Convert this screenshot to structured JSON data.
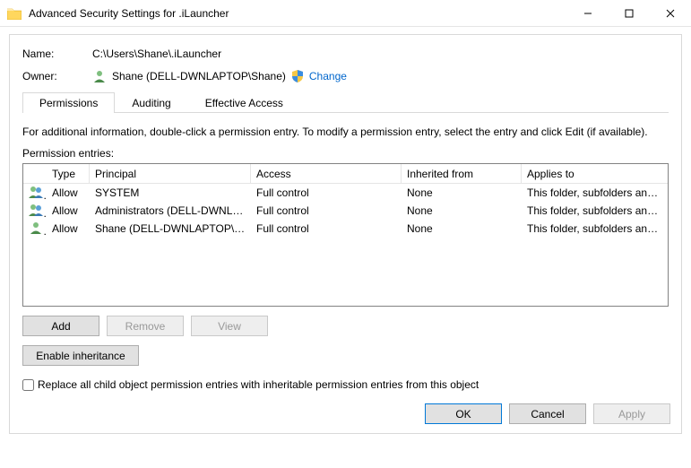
{
  "window": {
    "title": "Advanced Security Settings for .iLauncher"
  },
  "fields": {
    "name_label": "Name:",
    "name_value": "C:\\Users\\Shane\\.iLauncher",
    "owner_label": "Owner:",
    "owner_value": "Shane (DELL-DWNLAPTOP\\Shane)",
    "change_link": "Change"
  },
  "tabs": {
    "permissions": "Permissions",
    "auditing": "Auditing",
    "effective": "Effective Access"
  },
  "info_text": "For additional information, double-click a permission entry. To modify a permission entry, select the entry and click Edit (if available).",
  "entries_label": "Permission entries:",
  "columns": {
    "type": "Type",
    "principal": "Principal",
    "access": "Access",
    "inherited": "Inherited from",
    "applies": "Applies to"
  },
  "entries": [
    {
      "icon": "group",
      "type": "Allow",
      "principal": "SYSTEM",
      "access": "Full control",
      "inherited": "None",
      "applies": "This folder, subfolders and files"
    },
    {
      "icon": "group",
      "type": "Allow",
      "principal": "Administrators (DELL-DWNLA...",
      "access": "Full control",
      "inherited": "None",
      "applies": "This folder, subfolders and files"
    },
    {
      "icon": "user",
      "type": "Allow",
      "principal": "Shane (DELL-DWNLAPTOP\\Sh...",
      "access": "Full control",
      "inherited": "None",
      "applies": "This folder, subfolders and files"
    }
  ],
  "buttons": {
    "add": "Add",
    "remove": "Remove",
    "view": "View",
    "enable_inheritance": "Enable inheritance",
    "ok": "OK",
    "cancel": "Cancel",
    "apply": "Apply"
  },
  "checkbox": {
    "replace_child": "Replace all child object permission entries with inheritable permission entries from this object"
  }
}
